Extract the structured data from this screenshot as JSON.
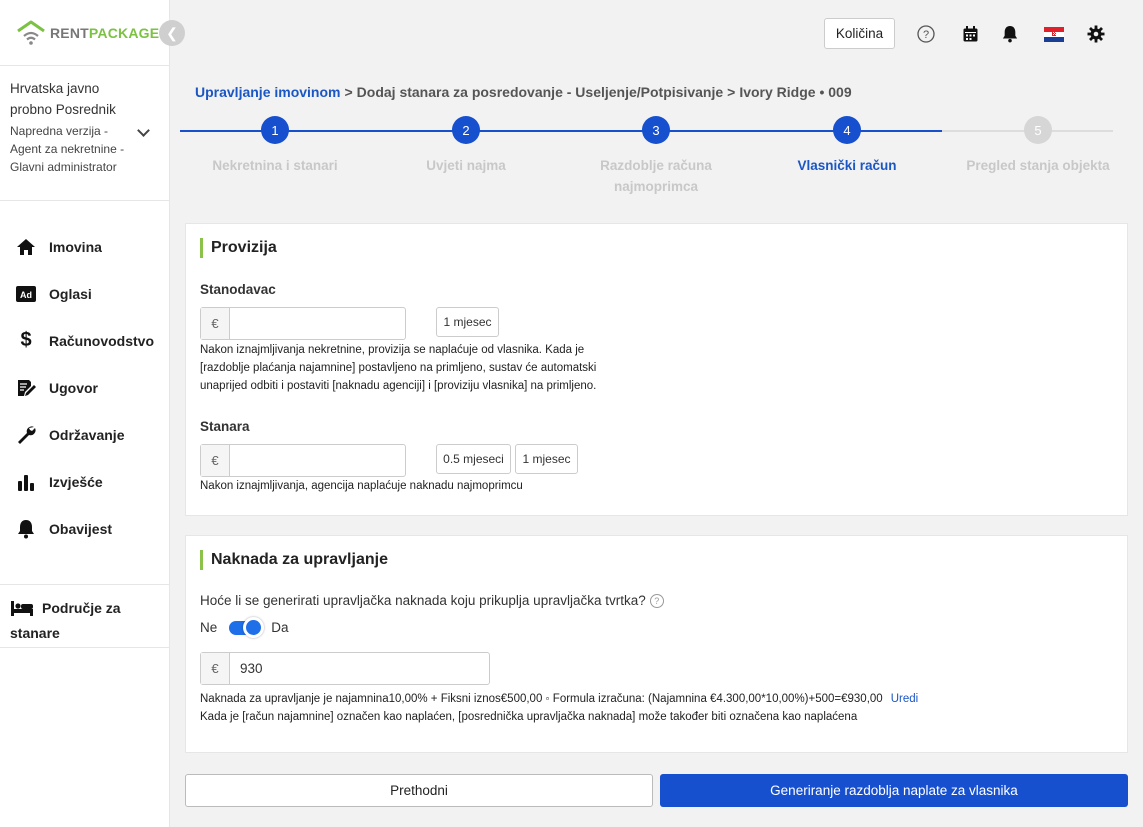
{
  "brand": {
    "part1": "RENT",
    "part2": "PACKAGE"
  },
  "account": {
    "name": "Hrvatska javno probno Posrednik",
    "role": "Napredna verzija - Agent za nekretnine - Glavni administrator"
  },
  "nav": {
    "items": [
      {
        "label": "Imovina",
        "icon": "home-icon"
      },
      {
        "label": "Oglasi",
        "icon": "ad-icon"
      },
      {
        "label": "Računovodstvo",
        "icon": "dollar-icon"
      },
      {
        "label": "Ugovor",
        "icon": "contract-icon"
      },
      {
        "label": "Održavanje",
        "icon": "wrench-icon"
      },
      {
        "label": "Izvješće",
        "icon": "bar-chart-icon"
      },
      {
        "label": "Obavijest",
        "icon": "bell-icon"
      }
    ],
    "tenant_area": "Područje za stanare"
  },
  "header": {
    "quantity_button": "Količina"
  },
  "breadcrumb": {
    "root": "Upravljanje imovinom",
    "step": "Dodaj stanara za posredovanje - Useljenje/Potpisivanje",
    "property": "Ivory Ridge • 009",
    "separator": ">"
  },
  "stepper": {
    "steps": [
      {
        "num": "1",
        "label": "Nekretnina i stanari",
        "state": "done"
      },
      {
        "num": "2",
        "label": "Uvjeti najma",
        "state": "done"
      },
      {
        "num": "3",
        "label": "Razdoblje računa najmoprimca",
        "state": "done"
      },
      {
        "num": "4",
        "label": "Vlasnički račun",
        "state": "active"
      },
      {
        "num": "5",
        "label": "Pregled stanja objekta",
        "state": "pending"
      }
    ]
  },
  "commission": {
    "title": "Provizija",
    "landlord": {
      "label": "Stanodavac",
      "currency": "€",
      "value": "",
      "chips": [
        "1 mjesec"
      ],
      "help": "Nakon iznajmljivanja nekretnine, provizija se naplaćuje od vlasnika. Kada je [razdoblje plaćanja najamnine] postavljeno na primljeno, sustav će automatski unaprijed odbiti i postaviti [naknadu agenciji] i [proviziju vlasnika] na primljeno."
    },
    "tenant": {
      "label": "Stanara",
      "currency": "€",
      "value": "",
      "chips": [
        "0.5 mjeseci",
        "1 mjesec"
      ],
      "help": "Nakon iznajmljivanja, agencija naplaćuje naknadu najmoprimcu"
    }
  },
  "management": {
    "title": "Naknada za upravljanje",
    "question": "Hoće li se generirati upravljačka naknada koju prikuplja upravljačka tvrtka?",
    "toggle_off": "Ne",
    "toggle_on": "Da",
    "toggle_state": "on",
    "currency": "€",
    "value": "930",
    "formula": "Naknada za upravljanje je najamnina10,00% + Fiksni iznos€500,00 ◦ Formula izračuna: (Najamnina €4.300,00*10,00%)+500=€930,00",
    "edit_link": "Uredi",
    "note": "Kada je [račun najamnine] označen kao naplaćen, [posrednička upravljačka naknada] može također biti označena kao naplaćena"
  },
  "footer": {
    "prev": "Prethodni",
    "next": "Generiranje razdoblja naplate za vlasnika"
  },
  "colors": {
    "primary": "#1650cf",
    "accent_green": "#7cc242",
    "step_inactive": "#cccccc"
  }
}
